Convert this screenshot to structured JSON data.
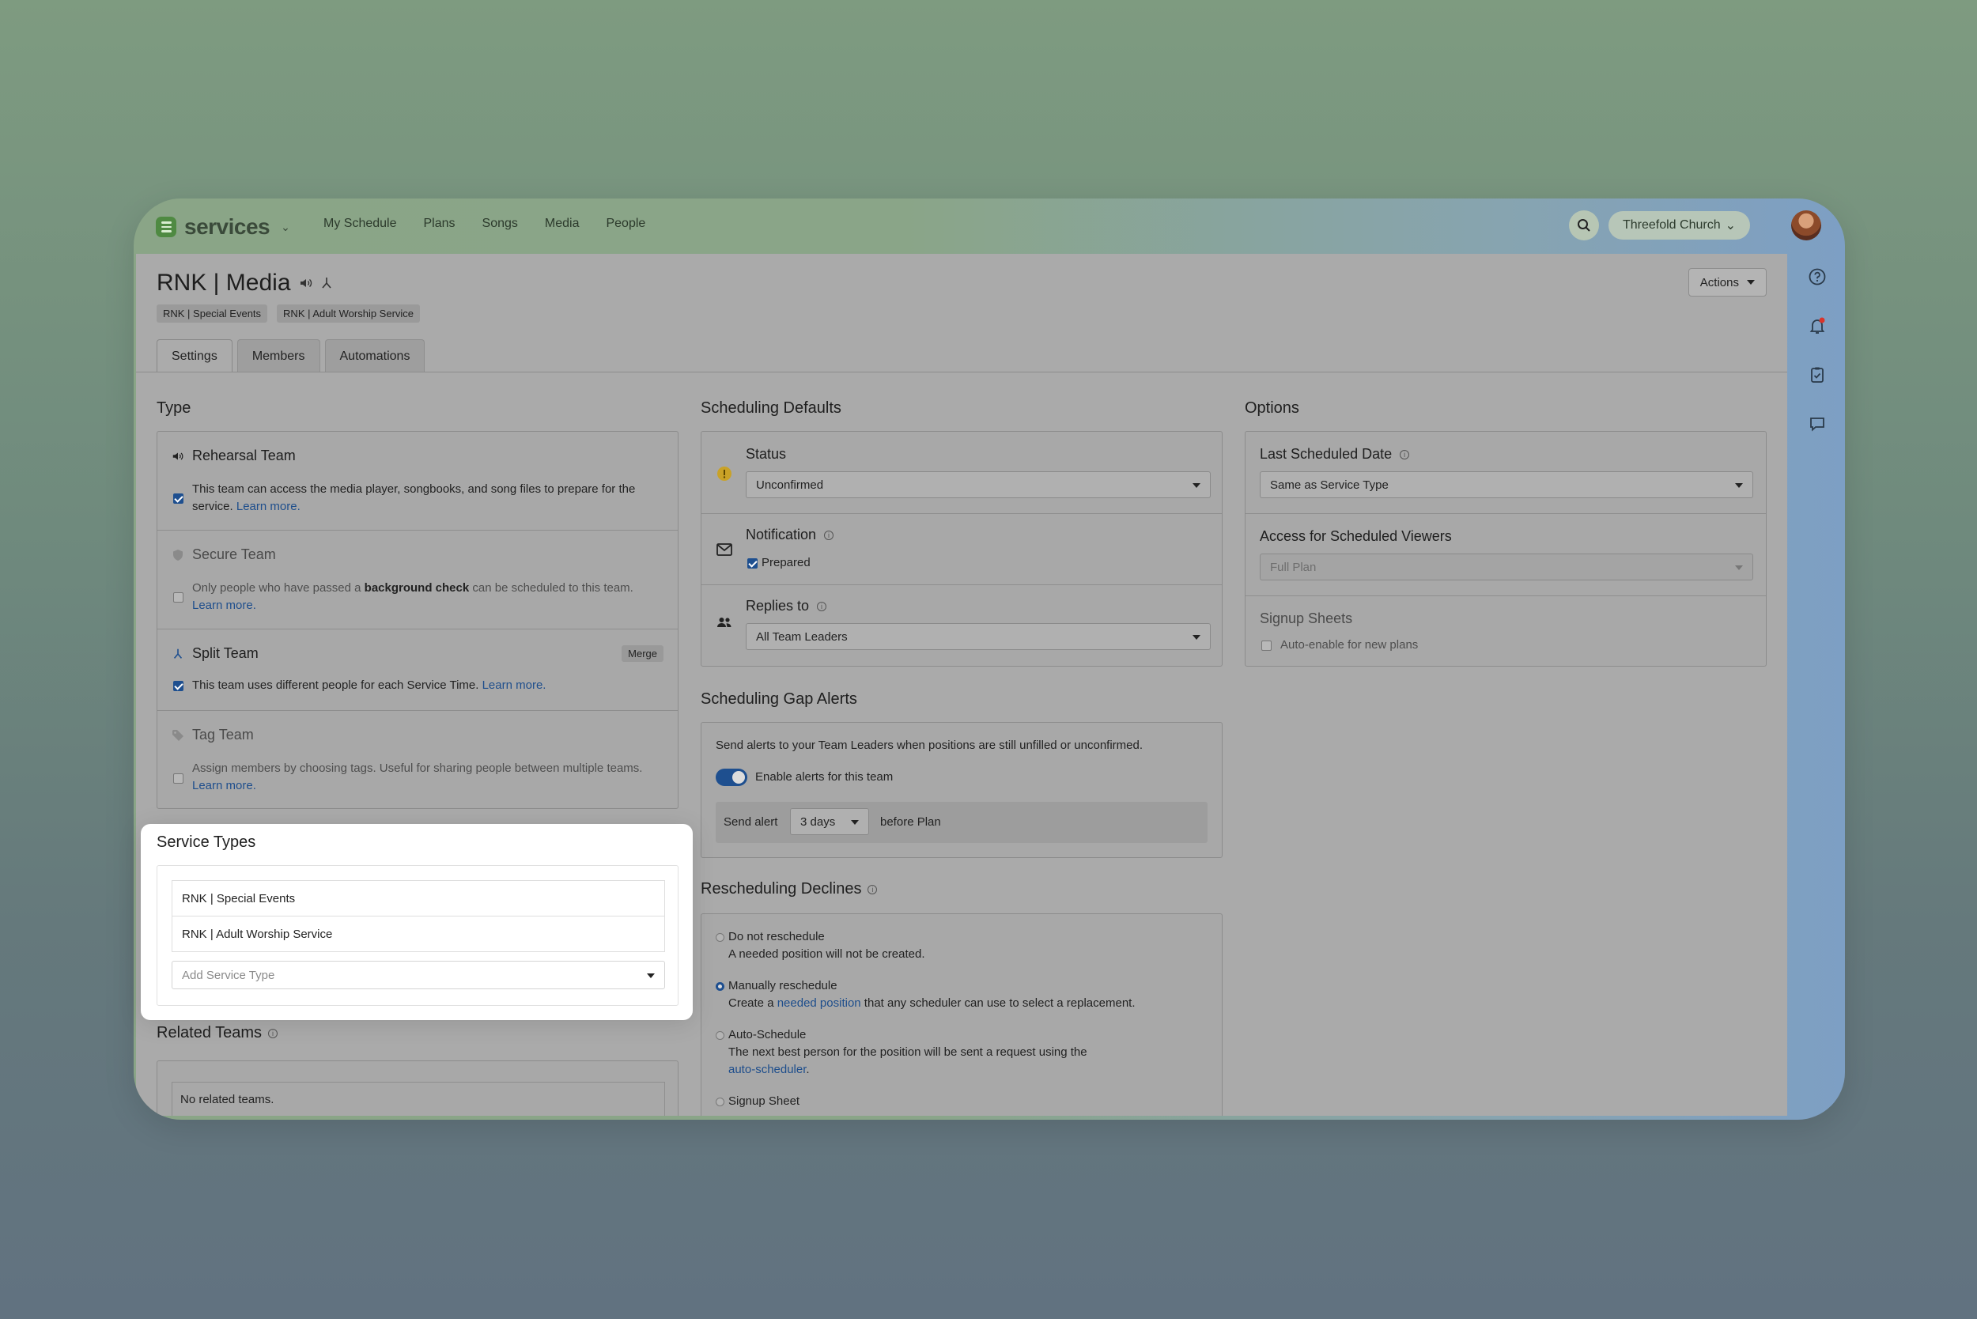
{
  "app": {
    "brand": "services",
    "nav": [
      "My Schedule",
      "Plans",
      "Songs",
      "Media",
      "People"
    ],
    "org": "Threefold Church"
  },
  "page": {
    "title": "RNK | Media",
    "chips": [
      "RNK | Special Events",
      "RNK | Adult Worship Service"
    ],
    "actions_label": "Actions",
    "tabs": [
      "Settings",
      "Members",
      "Automations"
    ]
  },
  "type_section": {
    "title": "Type",
    "rehearsal": {
      "title": "Rehearsal Team",
      "text": "This team can access the media player, songbooks, and song files to prepare for the service.",
      "link": "Learn more."
    },
    "secure": {
      "title": "Secure Team",
      "text_a": "Only people who have passed a ",
      "text_b": "background check",
      "text_c": " can be scheduled to this team.",
      "link": "Learn more."
    },
    "split": {
      "title": "Split Team",
      "merge": "Merge",
      "text": "This team uses different people for each Service Time.",
      "link": "Learn more."
    },
    "tag": {
      "title": "Tag Team",
      "text": "Assign members by choosing tags. Useful for sharing people between multiple teams.",
      "link": "Learn more."
    }
  },
  "service_types": {
    "title": "Service Types",
    "items": [
      "RNK | Special Events",
      "RNK | Adult Worship Service"
    ],
    "add_placeholder": "Add Service Type"
  },
  "related": {
    "title": "Related Teams",
    "empty": "No related teams."
  },
  "scheduling": {
    "title": "Scheduling Defaults",
    "status_label": "Status",
    "status_value": "Unconfirmed",
    "notification_label": "Notification",
    "notification_option": "Prepared",
    "replies_label": "Replies to",
    "replies_value": "All Team Leaders"
  },
  "gap_alerts": {
    "title": "Scheduling Gap Alerts",
    "description": "Send alerts to your Team Leaders when positions are still unfilled or unconfirmed.",
    "toggle_label": "Enable alerts for this team",
    "send_alert": "Send alert",
    "days_value": "3 days",
    "before_plan": "before Plan"
  },
  "declines": {
    "title": "Rescheduling Declines",
    "opt1_title": "Do not reschedule",
    "opt1_text": "A needed position will not be created.",
    "opt2_title": "Manually reschedule",
    "opt2_text_a": "Create a ",
    "opt2_link": "needed position",
    "opt2_text_b": " that any scheduler can use to select a replacement.",
    "opt3_title": "Auto-Schedule",
    "opt3_text": "The next best person for the position will be sent a request using the",
    "opt3_link": "auto-scheduler",
    "opt3_period": ".",
    "opt4_title": "Signup Sheet"
  },
  "options": {
    "title": "Options",
    "last_scheduled_label": "Last Scheduled Date",
    "last_scheduled_value": "Same as Service Type",
    "access_label": "Access for Scheduled Viewers",
    "access_value": "Full Plan",
    "signup_label": "Signup Sheets",
    "signup_option": "Auto-enable for new plans"
  },
  "colors": {
    "accent": "#1e4f8f",
    "brand_green": "#4f8a42",
    "warning": "#c9a227"
  }
}
